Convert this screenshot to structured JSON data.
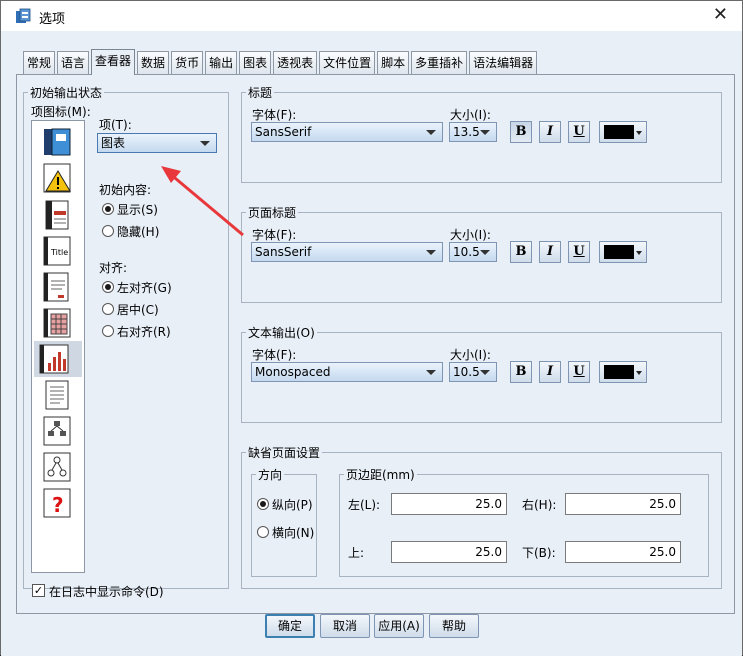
{
  "window": {
    "title": "选项"
  },
  "tabs": [
    {
      "label": "常规",
      "active": false
    },
    {
      "label": "语言",
      "active": false
    },
    {
      "label": "查看器",
      "active": true
    },
    {
      "label": "数据",
      "active": false
    },
    {
      "label": "货币",
      "active": false
    },
    {
      "label": "输出",
      "active": false
    },
    {
      "label": "图表",
      "active": false
    },
    {
      "label": "透视表",
      "active": false
    },
    {
      "label": "文件位置",
      "active": false
    },
    {
      "label": "脚本",
      "active": false
    },
    {
      "label": "多重插补",
      "active": false
    },
    {
      "label": "语法编辑器",
      "active": false
    }
  ],
  "initial_output": {
    "legend": "初始输出状态",
    "icon_list_label": "项图标(M):",
    "icons": [
      "log-icon",
      "warning-icon",
      "notes-icon",
      "title-icon",
      "text-output-icon",
      "table-icon",
      "chart-icon",
      "text-icon",
      "tree-model-icon",
      "diagram-icon",
      "unknown-icon"
    ],
    "selected_icon_index": 6,
    "item_label": "项(T):",
    "item_value": "图表",
    "initial_content_label": "初始内容:",
    "show_label": "显示(S)",
    "hide_label": "隐藏(H)",
    "content_selected": "show",
    "align_label": "对齐:",
    "align_left_label": "左对齐(G)",
    "align_center_label": "居中(C)",
    "align_right_label": "右对齐(R)",
    "align_selected": "left",
    "show_commands_label": "在日志中显示命令(D)",
    "show_commands_checked": true
  },
  "title_font": {
    "legend": "标题",
    "font_label": "字体(F):",
    "font_value": "SansSerif",
    "size_label": "大小(I):",
    "size_value": "13.5",
    "bold_pressed": true,
    "color": "#000000"
  },
  "page_title_font": {
    "legend": "页面标题",
    "font_label": "字体(F):",
    "font_value": "SansSerif",
    "size_label": "大小(I):",
    "size_value": "10.5",
    "color": "#000000"
  },
  "text_output_font": {
    "legend": "文本输出(O)",
    "font_label": "字体(F):",
    "font_value": "Monospaced",
    "size_label": "大小(I):",
    "size_value": "10.5",
    "color": "#000000"
  },
  "page_setup": {
    "legend": "缺省页面设置",
    "orientation_legend": "方向",
    "portrait_label": "纵向(P)",
    "landscape_label": "横向(N)",
    "orientation_selected": "portrait",
    "margins_legend": "页边距(mm)",
    "left_label": "左(L):",
    "left_value": "25.0",
    "right_label": "右(H):",
    "right_value": "25.0",
    "top_label": "上:",
    "top_value": "25.0",
    "bottom_label": "下(B):",
    "bottom_value": "25.0"
  },
  "buttons": {
    "ok": "确定",
    "cancel": "取消",
    "apply": "应用(A)",
    "help": "帮助"
  },
  "format_buttons": {
    "bold": "B",
    "italic": "I",
    "underline": "U"
  },
  "annotation_color": "#e8383c"
}
